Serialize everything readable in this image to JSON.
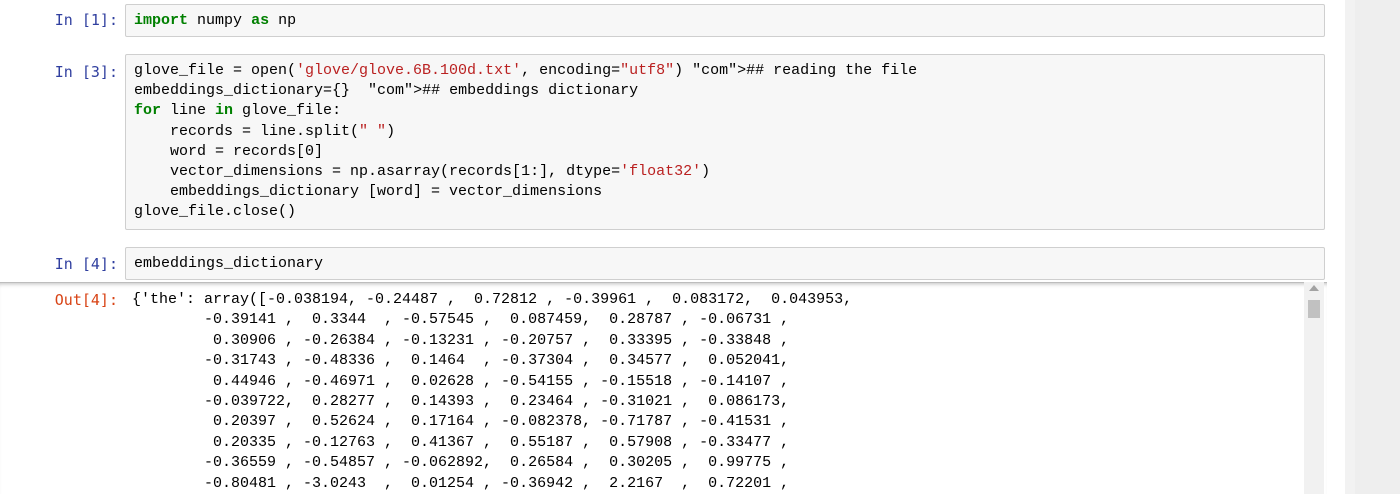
{
  "cells": [
    {
      "prompt": "In [1]:",
      "code": "import numpy as np"
    },
    {
      "prompt": "In [3]:",
      "code": "glove_file = open('glove/glove.6B.100d.txt', encoding=\"utf8\") ## reading the file\nembeddings_dictionary={}  ## embeddings dictionary\nfor line in glove_file:\n    records = line.split(\" \")\n    word = records[0]\n    vector_dimensions = np.asarray(records[1:], dtype='float32')\n    embeddings_dictionary [word] = vector_dimensions\nglove_file.close()"
    },
    {
      "prompt": "In [4]:",
      "code": "embeddings_dictionary"
    }
  ],
  "output": {
    "prompt": "Out[4]:",
    "text": "{'the': array([-0.038194, -0.24487 ,  0.72812 , -0.39961 ,  0.083172,  0.043953,\n        -0.39141 ,  0.3344  , -0.57545 ,  0.087459,  0.28787 , -0.06731 ,\n         0.30906 , -0.26384 , -0.13231 , -0.20757 ,  0.33395 , -0.33848 ,\n        -0.31743 , -0.48336 ,  0.1464  , -0.37304 ,  0.34577 ,  0.052041,\n         0.44946 , -0.46971 ,  0.02628 , -0.54155 , -0.15518 , -0.14107 ,\n        -0.039722,  0.28277 ,  0.14393 ,  0.23464 , -0.31021 ,  0.086173,\n         0.20397 ,  0.52624 ,  0.17164 , -0.082378, -0.71787 , -0.41531 ,\n         0.20335 , -0.12763 ,  0.41367 ,  0.55187 ,  0.57908 , -0.33477 ,\n        -0.36559 , -0.54857 , -0.062892,  0.26584 ,  0.30205 ,  0.99775 ,\n        -0.80481 , -3.0243  ,  0.01254 , -0.36942 ,  2.2167  ,  0.72201 ,"
  },
  "colors": {
    "input_prompt": "#303f9f",
    "output_prompt": "#d84315",
    "cell_background": "#f7f7f7",
    "cell_border": "#cfcfcf"
  }
}
